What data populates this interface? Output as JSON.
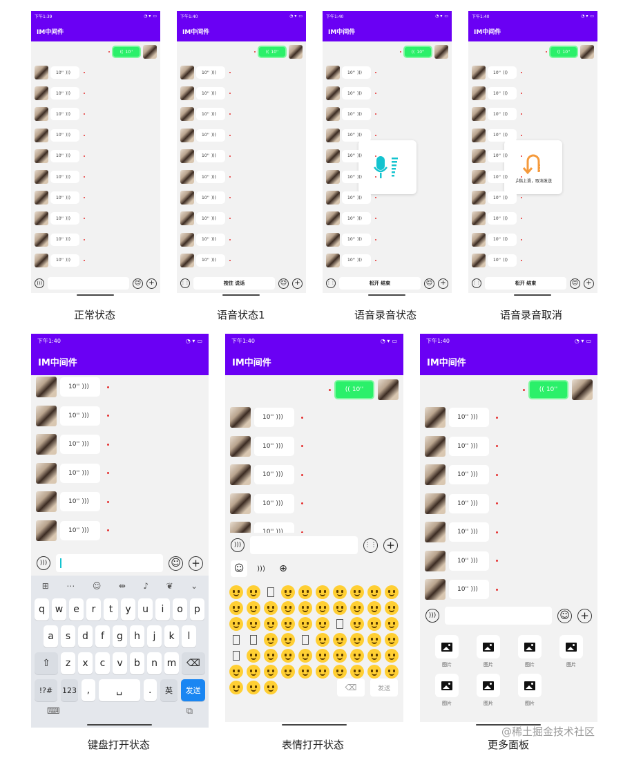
{
  "status_bars": {
    "p1": "下午1:39",
    "p2": "下午1:40",
    "p3": "下午1:40",
    "p4": "下午1:40",
    "p5": "下午1:40",
    "p6": "下午1:40",
    "p7": "下午1:40",
    "extra": "···"
  },
  "app_title": "IM中间件",
  "voice_duration": "10''",
  "captions": {
    "normal": "正常状态",
    "voice1": "语音状态1",
    "recording": "语音录音状态",
    "cancel": "语音录音取消",
    "keyboard": "键盘打开状态",
    "emoji": "表情打开状态",
    "more": "更多面板"
  },
  "input": {
    "hold_to_talk": "按住 说话",
    "release_to_end": "松开 结束"
  },
  "cancel_popup": {
    "text": "手指上滑，取消发送"
  },
  "keyboard": {
    "row1": [
      "q",
      "w",
      "e",
      "r",
      "t",
      "y",
      "u",
      "i",
      "o",
      "p"
    ],
    "row2": [
      "a",
      "s",
      "d",
      "f",
      "g",
      "h",
      "j",
      "k",
      "l"
    ],
    "row3": [
      "z",
      "x",
      "c",
      "v",
      "b",
      "n",
      "m"
    ],
    "sym": "!?#",
    "num": "123",
    "comma": ",",
    "period": ".",
    "lang": "英",
    "send": "发送"
  },
  "emoji_panel": {
    "send": "发送"
  },
  "more_panel": {
    "items": [
      "图片",
      "图片",
      "图片",
      "图片",
      "图片",
      "图片",
      "图片"
    ]
  },
  "watermark": "@稀土掘金技术社区",
  "colors": {
    "primary": "#6a00f4",
    "sent_bubble": "#2bf06a",
    "unread_dot": "#e53030",
    "send_key": "#1a86f2"
  }
}
